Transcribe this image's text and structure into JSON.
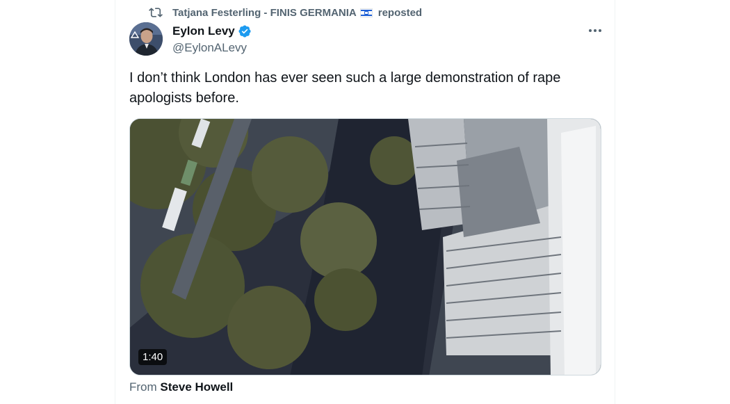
{
  "repost": {
    "user": "Tatjana Festerling - FINIS GERMANIA",
    "action": "reposted",
    "icon": "repost-icon",
    "flag": "israel-flag-emoji"
  },
  "author": {
    "display_name": "Eylon Levy",
    "handle": "@EylonALevy",
    "verified": true,
    "verified_color": "#1d9bf0"
  },
  "tweet": {
    "text": "I don’t think London has ever seen such a large demonstration of rape apologists before."
  },
  "media": {
    "type": "video",
    "duration": "1:40"
  },
  "source": {
    "prefix": "From",
    "name": "Steve Howell"
  },
  "colors": {
    "text_primary": "#0f1419",
    "text_secondary": "#536471",
    "border": "#eff3f4",
    "accent": "#1d9bf0"
  }
}
